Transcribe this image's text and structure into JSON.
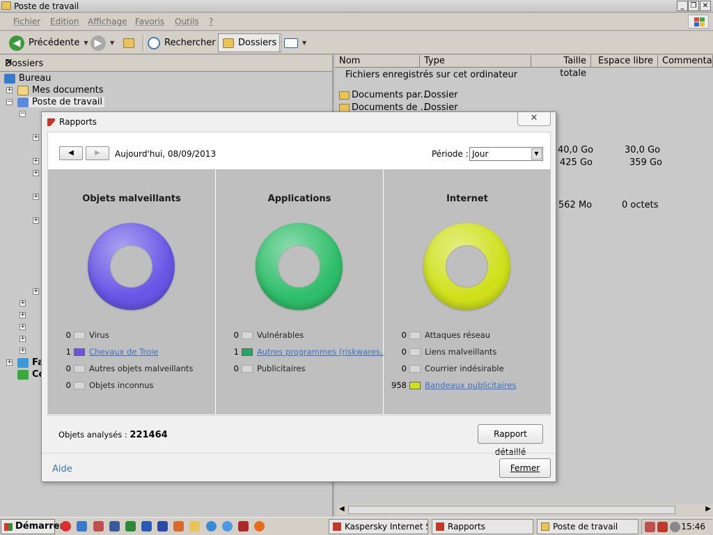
{
  "explorer": {
    "title": "Poste de travail",
    "menu": [
      "Fichier",
      "Edition",
      "Affichage",
      "Favoris",
      "Outils",
      "?"
    ],
    "toolbar": {
      "back": "Précédente",
      "search": "Rechercher",
      "folders": "Dossiers"
    },
    "folders_pane": {
      "title": "Dossiers",
      "close": "✕",
      "tree": [
        "Bureau",
        "Mes documents",
        "Poste de travail",
        "Fa",
        "Co"
      ]
    },
    "columns": [
      "Nom",
      "Type",
      "Taille totale",
      "Espace libre",
      "Commentaire"
    ],
    "group_label": "Fichiers enregistrés sur cet ordinateur",
    "rows": [
      {
        "name": "Documents par...",
        "type": "Dossier"
      },
      {
        "name": "Documents de ...",
        "type": "Dossier"
      }
    ],
    "sizes": [
      {
        "total": "40,0 Go",
        "free": "30,0 Go"
      },
      {
        "total": "425 Go",
        "free": "359 Go"
      },
      {
        "total": "562 Mo",
        "free": "0 octets"
      }
    ]
  },
  "dialog": {
    "title": "Rapports",
    "close": "✕",
    "date": "Aujourd'hui, 08/09/2013",
    "period_label": "Période :",
    "period_value": "Jour",
    "columns": [
      {
        "title": "Objets malveillants",
        "color": "#6a55e6",
        "items": [
          {
            "count": "0",
            "label": "Virus",
            "link": false,
            "color": ""
          },
          {
            "count": "1",
            "label": "Chevaux de Troie",
            "link": true,
            "color": "#6a55e6"
          },
          {
            "count": "0",
            "label": "Autres objets malveillants",
            "link": false,
            "color": ""
          },
          {
            "count": "0",
            "label": "Objets inconnus",
            "link": false,
            "color": ""
          }
        ]
      },
      {
        "title": "Applications",
        "color": "#2fbe6a",
        "items": [
          {
            "count": "0",
            "label": "Vulnérables",
            "link": false,
            "color": ""
          },
          {
            "count": "1",
            "label": "Autres programmes (riskwares,...)",
            "link": true,
            "color": "#1fa862"
          },
          {
            "count": "0",
            "label": "Publicitaires",
            "link": false,
            "color": ""
          }
        ]
      },
      {
        "title": "Internet",
        "color": "#cfe01a",
        "items": [
          {
            "count": "0",
            "label": "Attaques réseau",
            "link": false,
            "color": ""
          },
          {
            "count": "0",
            "label": "Liens malveillants",
            "link": false,
            "color": ""
          },
          {
            "count": "0",
            "label": "Courrier indésirable",
            "link": false,
            "color": ""
          },
          {
            "count": "958",
            "label": "Bandeaux publicitaires",
            "link": true,
            "color": "#cfe01a"
          }
        ]
      }
    ],
    "analyzed_label": "Objets analysés :",
    "analyzed_value": "221464",
    "detailed_report": "Rapport détaillé",
    "help": "Aide",
    "close_button": "Fermer"
  },
  "taskbar": {
    "start": "Démarrer",
    "tasks": [
      "Kaspersky Internet S...",
      "Rapports",
      "Poste de travail"
    ],
    "clock": "15:46"
  }
}
